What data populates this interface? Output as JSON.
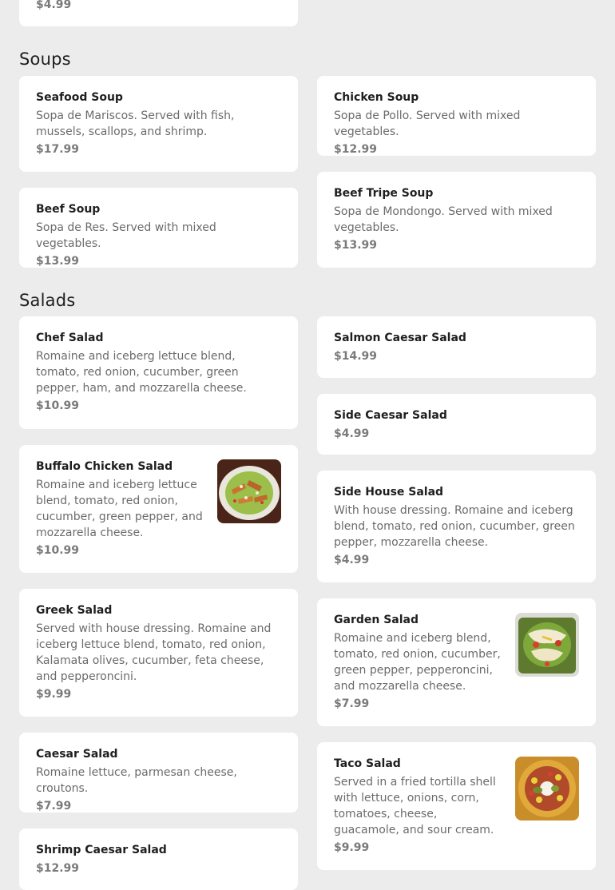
{
  "top_card": {
    "price": "$4.99"
  },
  "sections": {
    "soups": {
      "title": "Soups",
      "items": [
        {
          "name": "Seafood Soup",
          "desc": "Sopa de Mariscos. Served with fish, mussels, scallops, and shrimp.",
          "price": "$17.99"
        },
        {
          "name": "Chicken Soup",
          "desc": "Sopa de Pollo. Served with mixed vegetables.",
          "price": "$12.99"
        },
        {
          "name": "Beef Soup",
          "desc": "Sopa de Res. Served with mixed vegetables.",
          "price": "$13.99"
        },
        {
          "name": "Beef Tripe Soup",
          "desc": "Sopa de Mondongo. Served with mixed vegetables.",
          "price": "$13.99"
        }
      ]
    },
    "salads": {
      "title": "Salads",
      "items": [
        {
          "name": "Chef Salad",
          "desc": "Romaine and iceberg lettuce blend, tomato, red onion, cucumber, green pepper, ham, and mozzarella cheese.",
          "price": "$10.99"
        },
        {
          "name": "Salmon Caesar Salad",
          "price": "$14.99"
        },
        {
          "name": "Side Caesar Salad",
          "price": "$4.99"
        },
        {
          "name": "Buffalo Chicken Salad",
          "desc": "Romaine and iceberg lettuce blend, tomato, red onion, cucumber, green pepper, and mozzarella cheese.",
          "price": "$10.99",
          "image": "buffalo-chicken-salad-photo"
        },
        {
          "name": "Side House Salad",
          "desc": "With house dressing. Romaine and iceberg blend, tomato, red onion, cucumber, green pepper, mozzarella cheese.",
          "price": "$4.99"
        },
        {
          "name": "Greek Salad",
          "desc": "Served with house dressing. Romaine and iceberg lettuce blend, tomato, red onion, Kalamata olives, cucumber, feta cheese, and pepperoncini.",
          "price": "$9.99"
        },
        {
          "name": "Garden Salad",
          "desc": "Romaine and iceberg blend, tomato, red onion, cucumber, green pepper, pepperoncini, and mozzarella cheese.",
          "price": "$7.99",
          "image": "garden-salad-photo"
        },
        {
          "name": "Caesar Salad",
          "desc": "Romaine lettuce, parmesan cheese, croutons.",
          "price": "$7.99"
        },
        {
          "name": "Taco Salad",
          "desc": "Served in a fried tortilla shell with lettuce, onions, corn, tomatoes, cheese, guacamole, and sour cream.",
          "price": "$9.99",
          "image": "taco-salad-photo"
        },
        {
          "name": "Shrimp Caesar Salad",
          "price": "$12.99"
        }
      ]
    }
  }
}
